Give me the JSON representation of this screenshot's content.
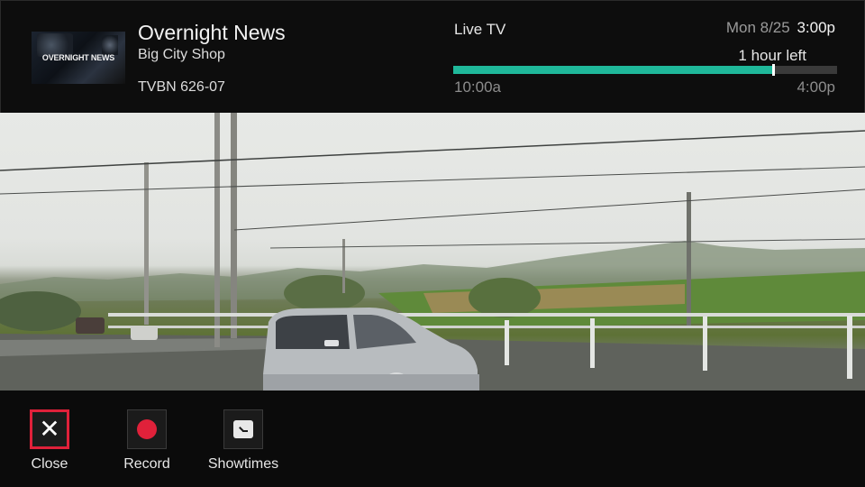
{
  "program": {
    "title": "Overnight News",
    "subtitle": "Big City Shop",
    "rating": "TVBN 626-07",
    "thumbnail_text": "OVERNIGHT NEWS"
  },
  "status": {
    "label": "Live TV",
    "date": "Mon 8/25",
    "time": "3:00p",
    "time_left": "1 hour left",
    "start_time": "10:00a",
    "end_time": "4:00p",
    "progress": 0.833
  },
  "colors": {
    "accent": "#1fb89a",
    "record": "#e0213a",
    "focus": "#e0213a"
  },
  "controls": [
    {
      "label": "Close",
      "icon": "close-icon",
      "focused": true
    },
    {
      "label": "Record",
      "icon": "record-icon",
      "focused": false
    },
    {
      "label": "Showtimes",
      "icon": "clock-icon",
      "focused": false
    }
  ]
}
